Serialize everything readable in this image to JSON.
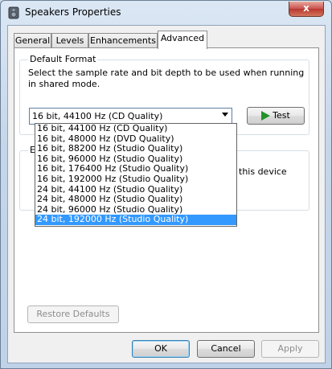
{
  "window": {
    "title": "Speakers Properties",
    "close_glyph": "x"
  },
  "tabs": [
    {
      "label": "General"
    },
    {
      "label": "Levels"
    },
    {
      "label": "Enhancements"
    },
    {
      "label": "Advanced"
    }
  ],
  "default_format": {
    "group_title": "Default Format",
    "description": "Select the sample rate and bit depth to be used when running in shared mode.",
    "selected_value": "16 bit, 44100 Hz (CD Quality)",
    "test_label": "Test",
    "options": [
      "16 bit, 44100 Hz (CD Quality)",
      "16 bit, 48000 Hz (DVD Quality)",
      "16 bit, 88200 Hz (Studio Quality)",
      "16 bit, 96000 Hz (Studio Quality)",
      "16 bit, 176400 Hz (Studio Quality)",
      "16 bit, 192000 Hz (Studio Quality)",
      "24 bit, 44100 Hz (Studio Quality)",
      "24 bit, 48000 Hz (Studio Quality)",
      "24 bit, 96000 Hz (Studio Quality)",
      "24 bit, 192000 Hz (Studio Quality)"
    ],
    "highlighted_option": "24 bit, 192000 Hz (Studio Quality)"
  },
  "exclusive_mode": {
    "group_title_partial": "E",
    "text_partial": "this device"
  },
  "buttons": {
    "restore_defaults": "Restore Defaults",
    "ok": "OK",
    "cancel": "Cancel",
    "apply": "Apply"
  },
  "colors": {
    "selection": "#3399ff",
    "test_play": "#22922a"
  }
}
